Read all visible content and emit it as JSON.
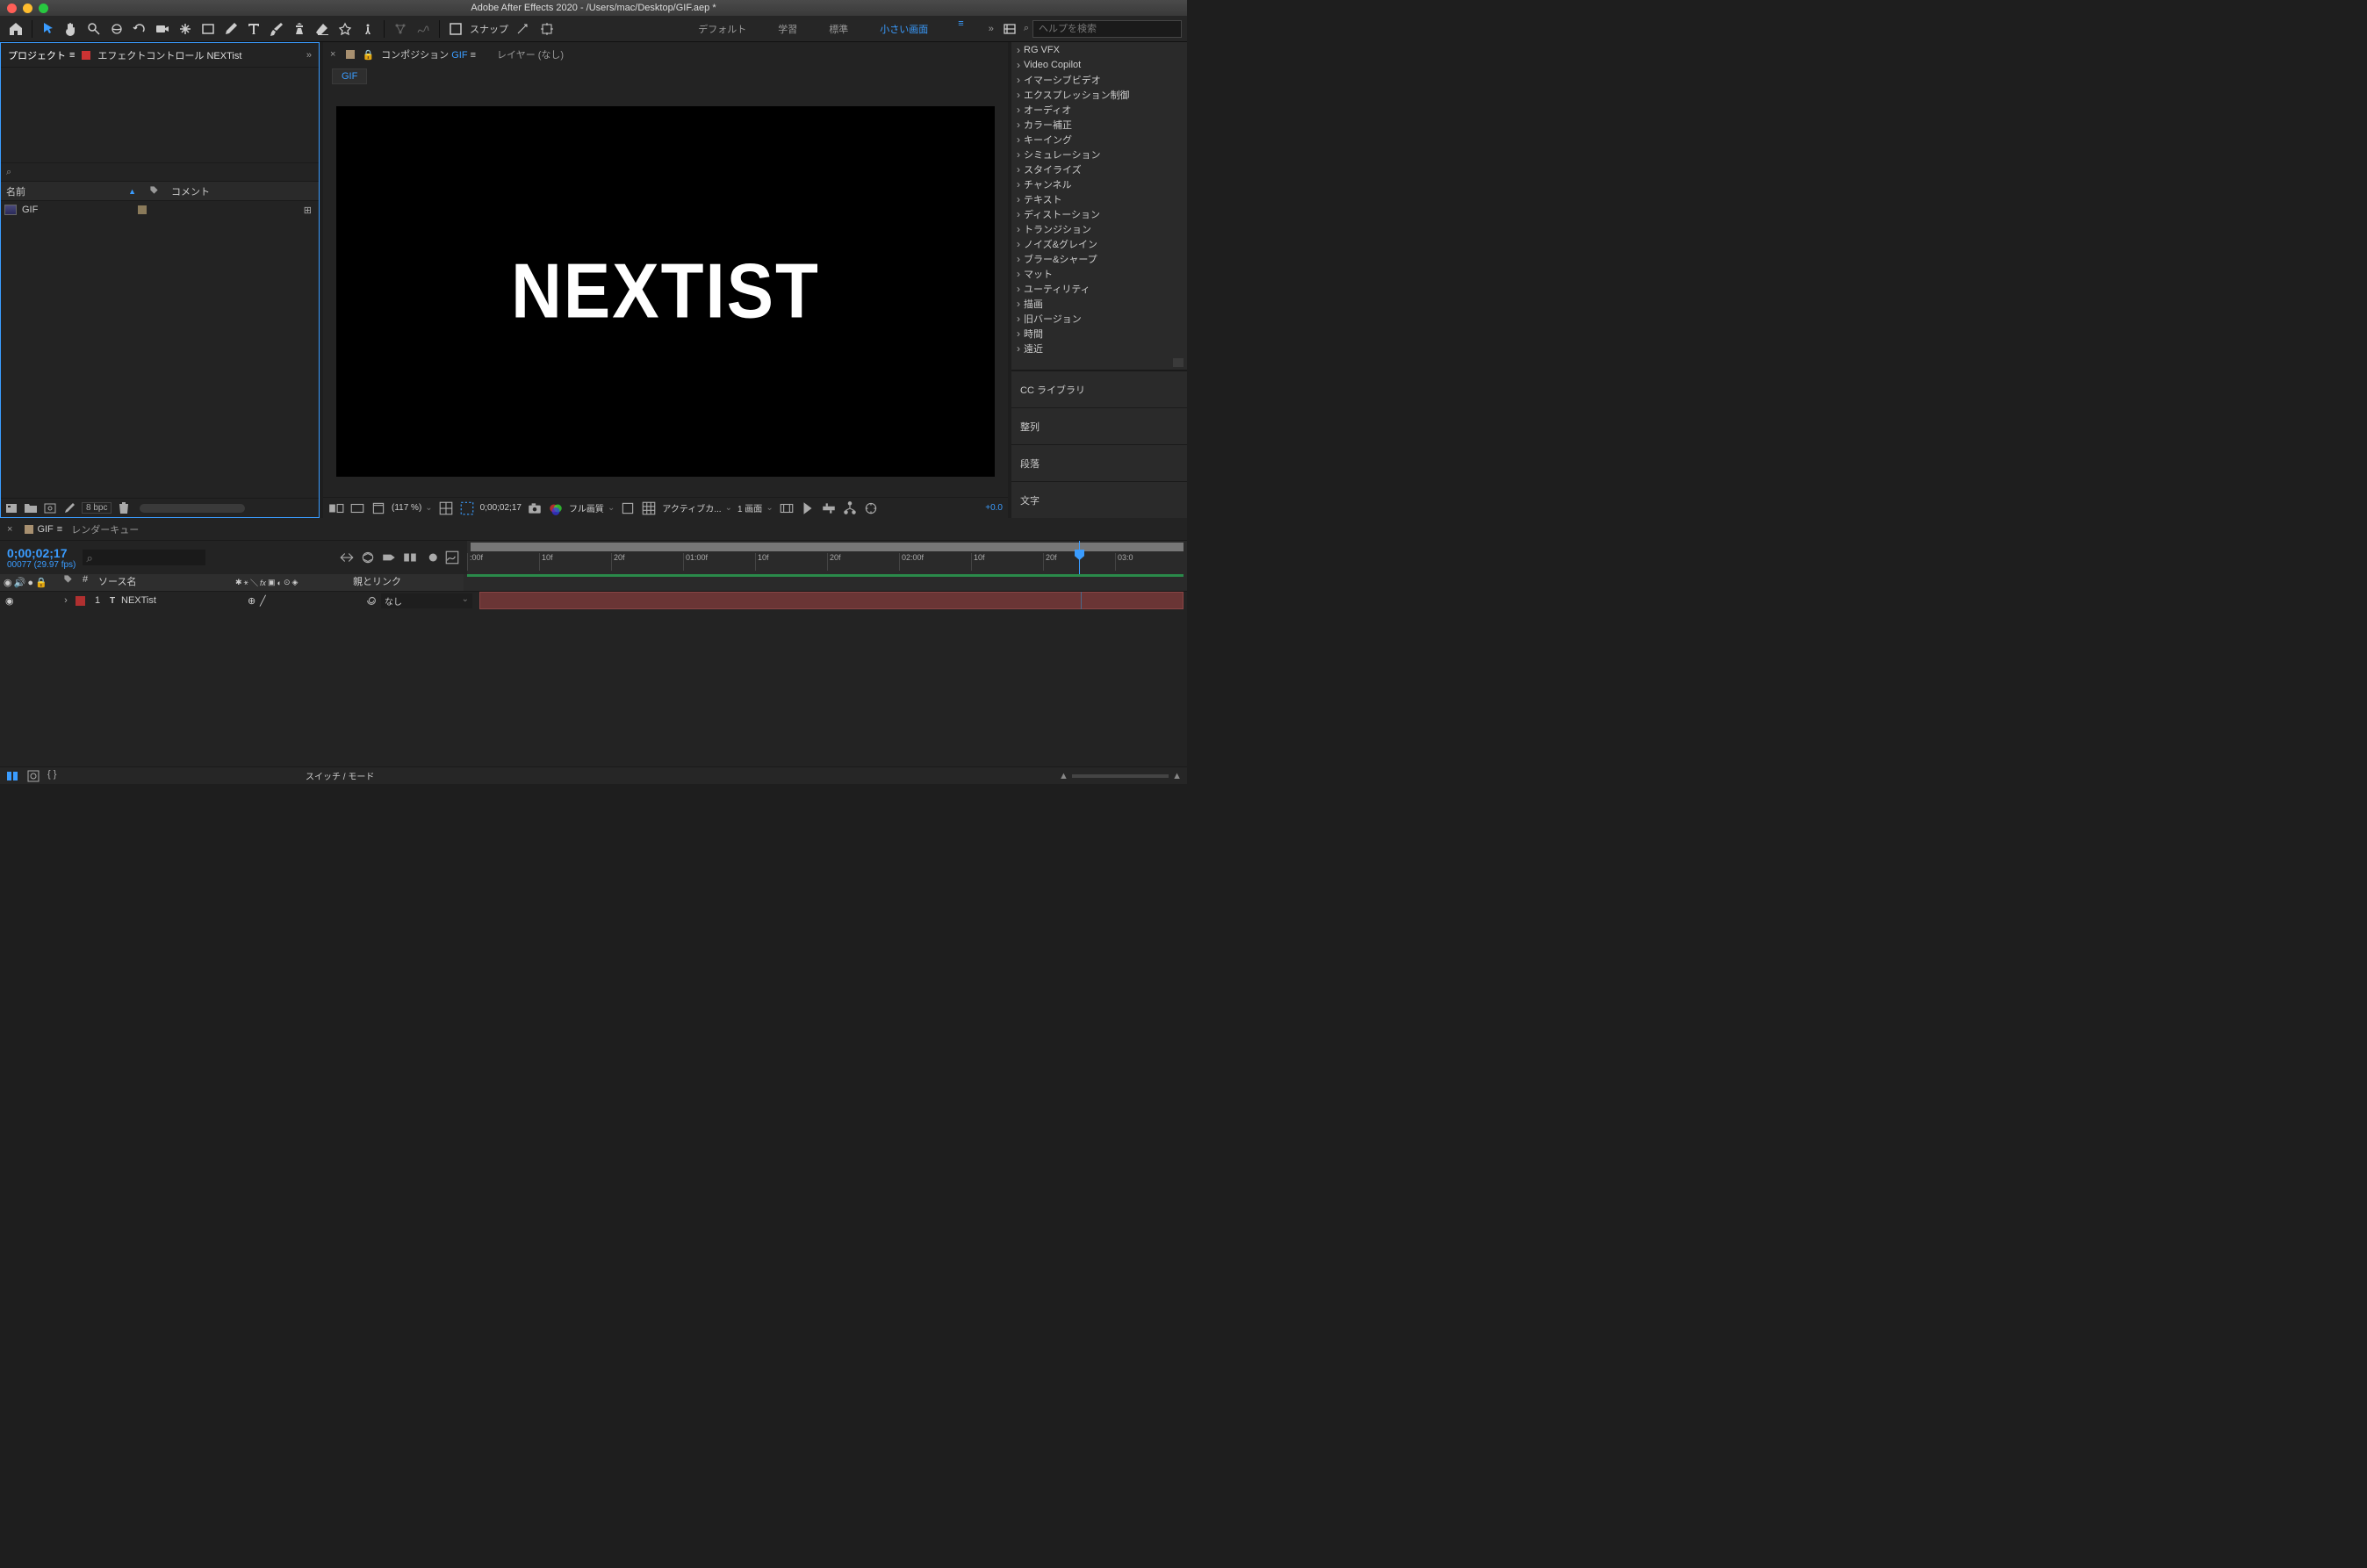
{
  "titlebar": {
    "title": "Adobe After Effects 2020 - /Users/mac/Desktop/GIF.aep *"
  },
  "toolbar": {
    "snap_label": "スナップ",
    "workspaces": [
      "デフォルト",
      "学習",
      "標準",
      "小さい画面"
    ],
    "active_workspace": 3,
    "search_placeholder": "ヘルプを検索"
  },
  "project_panel": {
    "tab_project": "プロジェクト",
    "tab_effect_controls": "エフェクトコントロール NEXTist",
    "col_name": "名前",
    "col_comment": "コメント",
    "items": [
      {
        "name": "GIF"
      }
    ],
    "bpc": "8 bpc"
  },
  "comp_panel": {
    "tab_composition": "コンポジション",
    "comp_name": "GIF",
    "tab_layer": "レイヤー (なし)",
    "crumb": "GIF",
    "display_text": "NEXTIST",
    "zoom": "(117 %)",
    "timecode": "0;00;02;17",
    "quality": "フル画質",
    "camera": "アクティブカ...",
    "views": "1 画面",
    "plus": "+0.0"
  },
  "effects_panel": {
    "items": [
      "RG VFX",
      "Video Copilot",
      "イマーシブビデオ",
      "エクスプレッション制御",
      "オーディオ",
      "カラー補正",
      "キーイング",
      "シミュレーション",
      "スタイライズ",
      "チャンネル",
      "テキスト",
      "ディストーション",
      "トランジション",
      "ノイズ&グレイン",
      "ブラー&シャープ",
      "マット",
      "ユーティリティ",
      "描画",
      "旧バージョン",
      "時間",
      "遠近"
    ],
    "sections": {
      "cc": "CC ライブラリ",
      "align": "整列",
      "paragraph": "段落",
      "char": "文字"
    }
  },
  "timeline": {
    "tab_name": "GIF",
    "tab_render": "レンダーキュー",
    "timecode": "0;00;02;17",
    "frame_info": "00077 (29.97 fps)",
    "col_num": "#",
    "col_source": "ソース名",
    "col_parent": "親とリンク",
    "ruler": [
      ":00f",
      "10f",
      "20f",
      "01:00f",
      "10f",
      "20f",
      "02:00f",
      "10f",
      "20f",
      "03:0"
    ],
    "playhead_percent": 85,
    "layers": [
      {
        "num": "1",
        "name": "NEXTist",
        "parent": "なし"
      }
    ],
    "switch_mode": "スイッチ / モード"
  }
}
